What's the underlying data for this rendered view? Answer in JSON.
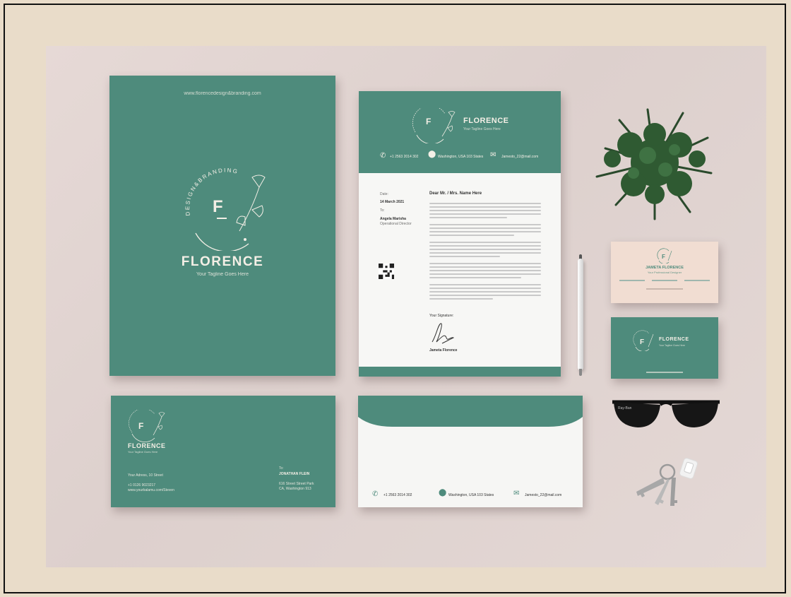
{
  "folder": {
    "url": "www.florencedesign&branding.com",
    "brand": "FLORENCE",
    "tagline": "Your Tagline Goes Here",
    "arc_text": "DESIGN&BRANDING",
    "monogram": "F"
  },
  "letterhead": {
    "brand": "FLORENCE",
    "tagline": "Your Tagline Goes Here",
    "phone": "+1 2563 2014 302",
    "address": "Washington, USA 103 States",
    "email": "Jamesto_22@mail.com",
    "date_label": "Date:",
    "date": "14 March 2021",
    "to_label": "To:",
    "recipient_name": "Angela Marisha",
    "recipient_title": "Operational Director",
    "salutation": "Dear Mr. / Mrs. Name Here",
    "signature_label": "Your Signature:",
    "signer": "Jameta Florence"
  },
  "envelope_front": {
    "brand": "FLORENCE",
    "tagline": "Your Tagline Goes Here",
    "sender_address": "Your Adress, 10 Street",
    "sender_phone": "+1 0126 9023217",
    "sender_web": "www.yourbalamu.com/Steven",
    "to_label": "To:",
    "recipient": "JONATHAN FLEIN",
    "recipient_addr1": "616 Street Street Park",
    "recipient_addr2": "CA, Washington 913"
  },
  "envelope_back": {
    "phone": "+1 2563 2014 302",
    "address": "Washington, USA 103 States",
    "email": "Jamesto_22@mail.com"
  },
  "card_front": {
    "name": "JAMETA FLORENCE",
    "title": "Your Professional Designer"
  },
  "card_back": {
    "brand": "FLORENCE",
    "tagline": "Your Tagline Goes Here"
  },
  "colors": {
    "teal": "#4e8b7c",
    "cream": "#f4efe6",
    "card_pink": "#f1ddd2",
    "backdrop": "#e9dcc9"
  }
}
